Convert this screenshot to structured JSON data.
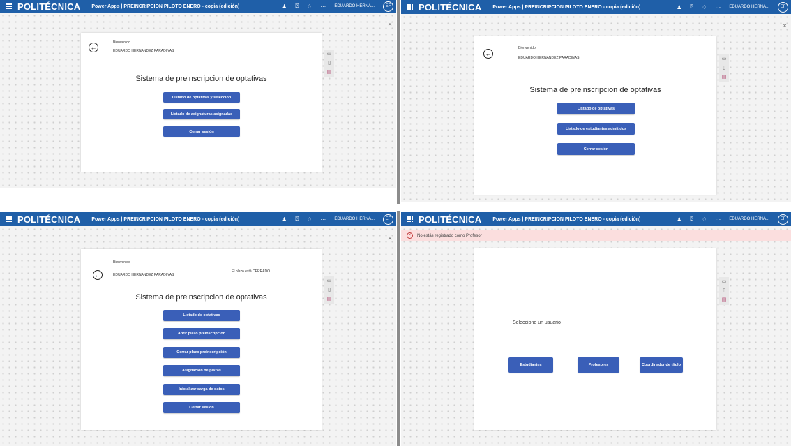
{
  "shared": {
    "brand": "POLITÉCNICA",
    "app_title": "Power Apps | PREINCRIPCION PILOTO ENERO - copia (edición)",
    "more": "···",
    "avatar": "EF",
    "close": "×",
    "back_icon": "arrow-left-icon",
    "welcome": "Bienvenido",
    "username": "EDUARDO HERNANDEZ PARADINAS",
    "card_title": "Sistema de preinscripcion de optativas"
  },
  "topbar_user": {
    "q1": "EDUARDO HERNA...",
    "q2": "EDUARDO HERNA...",
    "q3": "EDUARDO HERNA...",
    "q4": "EDUARDO HERNA..."
  },
  "q1": {
    "buttons": [
      "Listado de optativas y selección",
      "Listado de asignaturas asignadas",
      "Cerrar sesión"
    ]
  },
  "q2": {
    "buttons": [
      "Listado de optativas",
      "Listado de estudiantes admitidos",
      "Cerrar sesión"
    ]
  },
  "q3": {
    "plazo_status": "El plazo está CERRADO",
    "buttons": [
      "Listado de optativas",
      "Abrir plazo preinscripción",
      "Cerrar plazo preinscripción",
      "Asignación de plazas",
      "Inicializar carga de datos",
      "Cerrar sesión"
    ]
  },
  "q4": {
    "error": "No estás registrado como Profesor",
    "select_label": "Seleccione un usuario",
    "buttons": [
      "Estudiantes",
      "Profesores",
      "Coordinador de título"
    ]
  },
  "colors": {
    "topbar": "#1f5fa8",
    "button": "#3a5fb8",
    "error_bg": "#fbdede"
  }
}
